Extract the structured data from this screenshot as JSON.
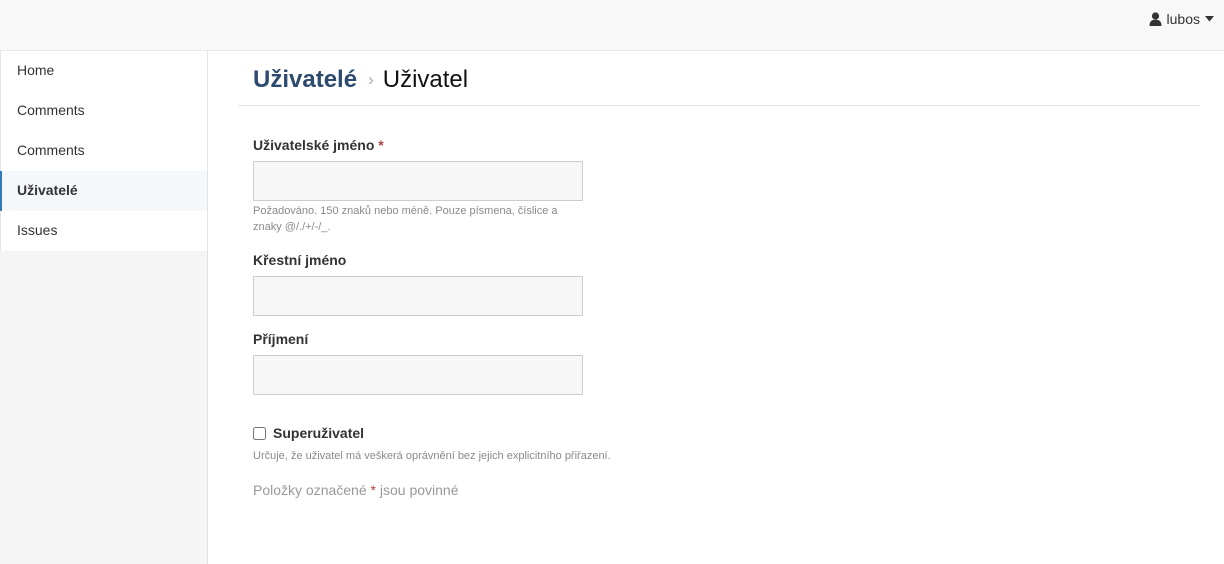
{
  "header": {
    "user_name": "lubos",
    "user_icon": "user-icon",
    "caret_icon": "caret-down-icon"
  },
  "sidebar": {
    "items": [
      {
        "label": "Home"
      },
      {
        "label": "Comments"
      },
      {
        "label": "Comments"
      },
      {
        "label": "Uživatelé",
        "active": true
      },
      {
        "label": "Issues"
      }
    ]
  },
  "breadcrumb": {
    "parent": "Uživatelé",
    "separator": "›",
    "current": "Uživatel"
  },
  "form": {
    "username": {
      "label": "Uživatelské jméno",
      "required_mark": "*",
      "value": "",
      "help": "Požadováno. 150 znaků nebo méně. Pouze písmena, číslice a znaky @/./+/-/_."
    },
    "first_name": {
      "label": "Křestní jméno",
      "value": ""
    },
    "last_name": {
      "label": "Příjmení",
      "value": ""
    },
    "superuser": {
      "label": "Superuživatel",
      "checked": false,
      "help": "Určuje, že uživatel má veškerá oprávnění bez jejich explicitního přiřazení."
    },
    "required_note": {
      "before": "Položky označené",
      "mark": "*",
      "after": "jsou povinné"
    }
  },
  "colors": {
    "accent": "#337ab7",
    "breadcrumb_link": "#2c4b6e",
    "required": "#a94442"
  }
}
